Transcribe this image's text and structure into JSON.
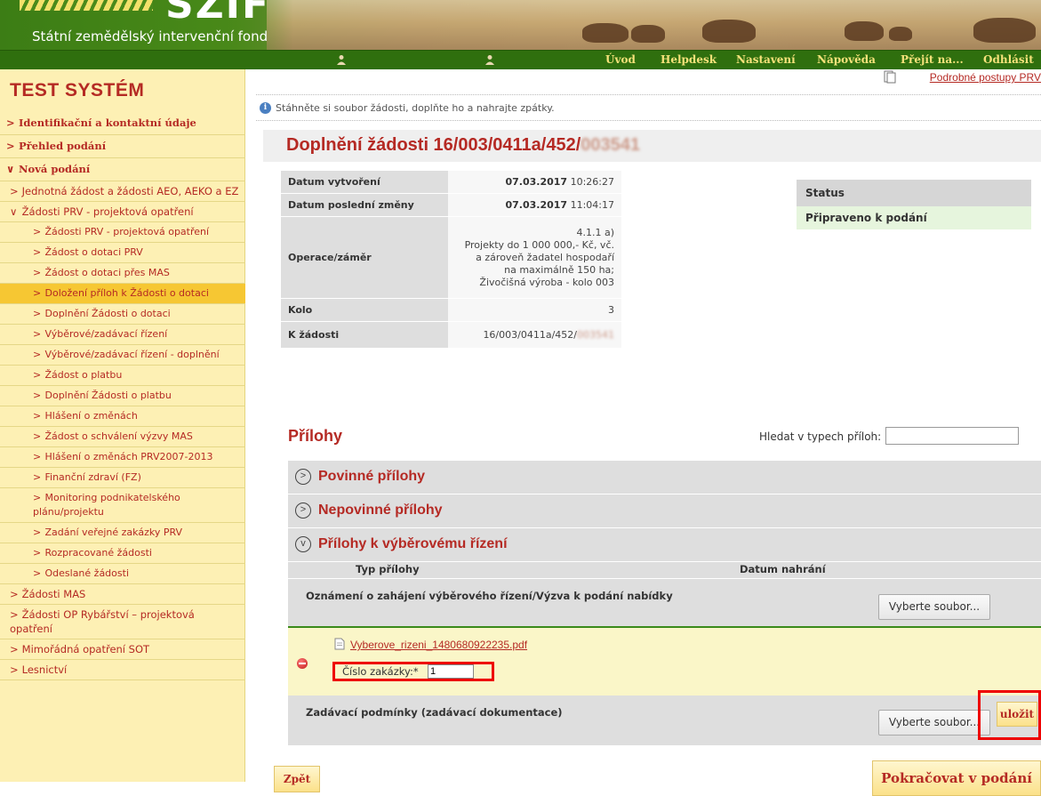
{
  "header": {
    "logo_text": "SZIF",
    "org_name": "Státní zemědělský intervenční fond"
  },
  "nav": {
    "items": [
      "Úvod",
      "Helpdesk",
      "Nastavení",
      "Nápověda",
      "Přejít na...",
      "Odhlásit"
    ]
  },
  "sidebar": {
    "title": "TEST SYSTÉM",
    "items": [
      {
        "label": "Identifikační a kontaktní údaje",
        "level": 0,
        "arrow": ">"
      },
      {
        "label": "Přehled podání",
        "level": 0,
        "arrow": ">"
      },
      {
        "label": "Nová podání",
        "level": 0,
        "arrow": "v"
      },
      {
        "label": "Jednotná žádost a žádosti AEO, AEKO a EZ",
        "level": 1,
        "arrow": ">"
      },
      {
        "label": "Žádosti PRV - projektová opatření",
        "level": 1,
        "arrow": "v"
      },
      {
        "label": "Žádosti PRV - projektová opatření",
        "level": 2,
        "arrow": ">"
      },
      {
        "label": "Žádost o dotaci PRV",
        "level": 2,
        "arrow": ">"
      },
      {
        "label": "Žádost o dotaci přes MAS",
        "level": 2,
        "arrow": ">"
      },
      {
        "label": "Doložení příloh k Žádosti o dotaci",
        "level": 2,
        "arrow": ">",
        "active": true
      },
      {
        "label": "Doplnění Žádosti o dotaci",
        "level": 2,
        "arrow": ">"
      },
      {
        "label": "Výběrové/zadávací řízení",
        "level": 2,
        "arrow": ">"
      },
      {
        "label": "Výběrové/zadávací řízení - doplnění",
        "level": 2,
        "arrow": ">"
      },
      {
        "label": "Žádost o platbu",
        "level": 2,
        "arrow": ">"
      },
      {
        "label": "Doplnění Žádosti o platbu",
        "level": 2,
        "arrow": ">"
      },
      {
        "label": "Hlášení o změnách",
        "level": 2,
        "arrow": ">"
      },
      {
        "label": "Žádost o schválení výzvy MAS",
        "level": 2,
        "arrow": ">"
      },
      {
        "label": "Hlášení o změnách PRV2007-2013",
        "level": 2,
        "arrow": ">"
      },
      {
        "label": "Finanční zdraví (FZ)",
        "level": 2,
        "arrow": ">"
      },
      {
        "label": "Monitoring podnikatelského plánu/projektu",
        "level": 2,
        "arrow": ">"
      },
      {
        "label": "Zadání veřejné zakázky PRV",
        "level": 2,
        "arrow": ">"
      },
      {
        "label": "Rozpracované žádosti",
        "level": 2,
        "arrow": ">"
      },
      {
        "label": "Odeslané žádosti",
        "level": 2,
        "arrow": ">"
      },
      {
        "label": "Žádosti MAS",
        "level": 1,
        "arrow": ">"
      },
      {
        "label": "Žádosti OP Rybářství – projektová opatření",
        "level": 1,
        "arrow": ">"
      },
      {
        "label": "Mimořádná opatření SOT",
        "level": 1,
        "arrow": ">"
      },
      {
        "label": "Lesnictví",
        "level": 1,
        "arrow": ">"
      }
    ]
  },
  "main": {
    "top_link": "Podrobné postupy PRV",
    "info_text": "Stáhněte si soubor žádosti, doplňte ho a nahrajte zpátky.",
    "title_prefix": "Doplnění žádosti 16/003/0411a/452/",
    "title_blurred": "003541",
    "meta": [
      {
        "key": "Datum vytvoření",
        "date": "07.03.2017",
        "time": "10:26:27"
      },
      {
        "key": "Datum poslední změny",
        "date": "07.03.2017",
        "time": "11:04:17"
      },
      {
        "key": "Operace/záměr",
        "lines": [
          "4.1.1 a)",
          "Projekty do 1 000 000,- Kč, vč.",
          "a zároveň žadatel hospodaří",
          "na maximálně 150 ha;",
          "Živočišná výroba - kolo 003"
        ]
      },
      {
        "key": "Kolo",
        "value": "3"
      },
      {
        "key": "K žádosti",
        "value": "16/003/0411a/452/",
        "blurred": "003541"
      }
    ],
    "status": {
      "label": "Status",
      "value": "Připraveno k podání"
    },
    "attachments": {
      "title": "Přílohy",
      "search_label": "Hledat v typech příloh:",
      "search_value": "",
      "groups": [
        {
          "label": "Povinné přílohy",
          "expanded": false
        },
        {
          "label": "Nepovinné přílohy",
          "expanded": false
        },
        {
          "label": "Přílohy k výběrovému řízení",
          "expanded": true
        }
      ],
      "col_type": "Typ přílohy",
      "col_date": "Datum nahrání",
      "row1_type": "Oznámení o zahájení výběrového řízení/Výzva k podání nabídky",
      "file_button": "Vyberte soubor...",
      "uploaded_file": "Vyberove_rizeni_1480680922235.pdf",
      "contract_label": "Číslo zakázky:*",
      "contract_value": "1",
      "row2_type": "Zadávací podmínky (zadávací dokumentace)"
    },
    "save_button": "uložit",
    "back_button": "Zpět",
    "continue_button": "Pokračovat v podání"
  }
}
